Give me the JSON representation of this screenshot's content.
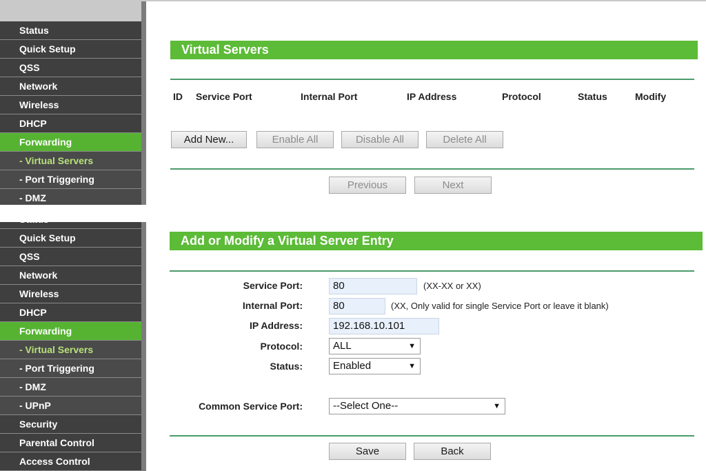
{
  "top": {
    "sidebar": [
      {
        "label": "Status"
      },
      {
        "label": "Quick Setup"
      },
      {
        "label": "QSS"
      },
      {
        "label": "Network"
      },
      {
        "label": "Wireless"
      },
      {
        "label": "DHCP"
      },
      {
        "label": "Forwarding"
      },
      {
        "label": "- Virtual Servers"
      },
      {
        "label": "- Port Triggering"
      },
      {
        "label": "- DMZ"
      }
    ],
    "title": "Virtual Servers",
    "columns": [
      "ID",
      "Service Port",
      "Internal Port",
      "IP Address",
      "Protocol",
      "Status",
      "Modify"
    ],
    "buttons": {
      "add_new": "Add New...",
      "enable_all": "Enable All",
      "disable_all": "Disable All",
      "delete_all": "Delete All",
      "previous": "Previous",
      "next": "Next"
    }
  },
  "bottom": {
    "sidebar": [
      {
        "label": "Status"
      },
      {
        "label": "Quick Setup"
      },
      {
        "label": "QSS"
      },
      {
        "label": "Network"
      },
      {
        "label": "Wireless"
      },
      {
        "label": "DHCP"
      },
      {
        "label": "Forwarding"
      },
      {
        "label": "- Virtual Servers"
      },
      {
        "label": "- Port Triggering"
      },
      {
        "label": "- DMZ"
      },
      {
        "label": "- UPnP"
      },
      {
        "label": "Security"
      },
      {
        "label": "Parental Control"
      },
      {
        "label": "Access Control"
      }
    ],
    "title": "Add or Modify a Virtual Server Entry",
    "form": {
      "service_port": {
        "label": "Service Port:",
        "value": "80",
        "hint": "(XX-XX or XX)"
      },
      "internal_port": {
        "label": "Internal Port:",
        "value": "80",
        "hint": "(XX, Only valid for single Service Port or leave it blank)"
      },
      "ip_address": {
        "label": "IP Address:",
        "value": "192.168.10.101"
      },
      "protocol": {
        "label": "Protocol:",
        "value": "ALL"
      },
      "status": {
        "label": "Status:",
        "value": "Enabled"
      },
      "common_service_port": {
        "label": "Common Service Port:",
        "value": "--Select One--"
      }
    },
    "buttons": {
      "save": "Save",
      "back": "Back"
    }
  },
  "icons": {
    "select_arrow": "▼"
  },
  "colors": {
    "accent": "#5cbb37",
    "sidebar_bg": "#3f3f3f",
    "active_sub_text": "#b7e27a"
  }
}
